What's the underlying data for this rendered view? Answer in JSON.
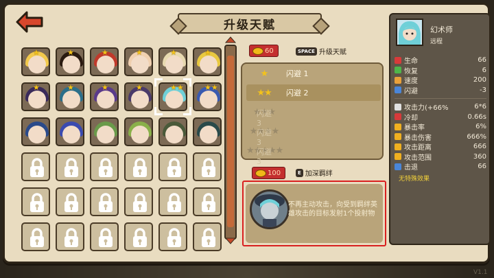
{
  "title": "升级天赋",
  "hero": {
    "name": "幻术师",
    "role": "远程"
  },
  "talent": {
    "cost": "60",
    "key": "SPACE",
    "action": "升级天赋",
    "levels": [
      {
        "stars": "★",
        "label": "闪避 1",
        "unlocked": true
      },
      {
        "stars": "★★",
        "label": "闪避 2",
        "unlocked": true
      },
      {
        "stars": "★★★",
        "label": "闪避 3",
        "unlocked": false
      },
      {
        "stars": "★★★★",
        "label": "闪避 3",
        "unlocked": false
      },
      {
        "stars": "★★★★★",
        "label": "闪避 3",
        "unlocked": false
      }
    ]
  },
  "bond": {
    "cost": "100",
    "key": "E",
    "action": "加深羁绊",
    "description": "不再主动攻击，向受到羁绊英雄攻击的目标发射1个投射物"
  },
  "stats_primary": [
    {
      "name": "生命",
      "value": "66",
      "icon_color": "#d83a3a"
    },
    {
      "name": "恢复",
      "value": "6",
      "icon_color": "#4fb64a"
    },
    {
      "name": "速度",
      "value": "200",
      "icon_color": "#e9a13a"
    },
    {
      "name": "闪避",
      "value": "-3",
      "icon_color": "#4a86d8"
    }
  ],
  "stats_secondary": [
    {
      "name": "攻击力(+66%",
      "value": "6*6",
      "icon_color": "#e0e0e0"
    },
    {
      "name": "冷却",
      "value": "0.66s",
      "icon_color": "#d83a3a"
    },
    {
      "name": "暴击率",
      "value": "6%",
      "icon_color": "#f0b020"
    },
    {
      "name": "暴击伤害",
      "value": "666%",
      "icon_color": "#f0b020"
    },
    {
      "name": "攻击距离",
      "value": "666",
      "icon_color": "#f0b020"
    },
    {
      "name": "攻击范围",
      "value": "360",
      "icon_color": "#f0b020"
    },
    {
      "name": "击退",
      "value": "66",
      "icon_color": "#4a86d8"
    }
  ],
  "no_special_effect": "无特殊效果",
  "version": "V1.1"
}
